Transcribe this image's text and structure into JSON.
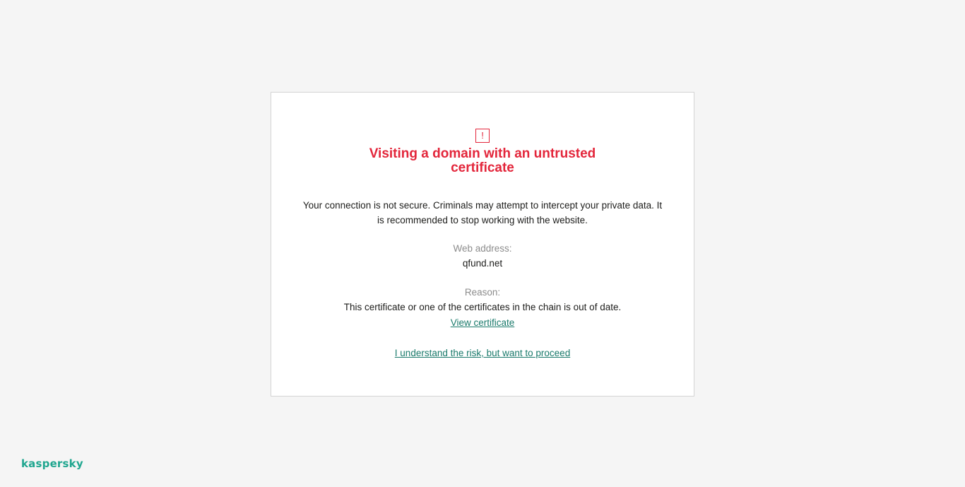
{
  "warning": {
    "icon": "exclamation-icon",
    "glyph": "!",
    "title": "Visiting a domain with an untrusted certificate",
    "description": "Your connection is not secure. Criminals may attempt to intercept your private data. It is recommended to stop working with the website.",
    "web_address_label": "Web address:",
    "web_address_value": "qfund.net",
    "reason_label": "Reason:",
    "reason_value": "This certificate or one of the certificates in the chain is out of date.",
    "view_certificate_link": "View certificate",
    "proceed_link": "I understand the risk, but want to proceed"
  },
  "brand": {
    "logo_text": "kaspersky"
  },
  "colors": {
    "background": "#f5f5f5",
    "card": "#ffffff",
    "title_red": "#e3263b",
    "link_teal": "#1a7a6b",
    "brand_teal": "#1fa68f"
  }
}
